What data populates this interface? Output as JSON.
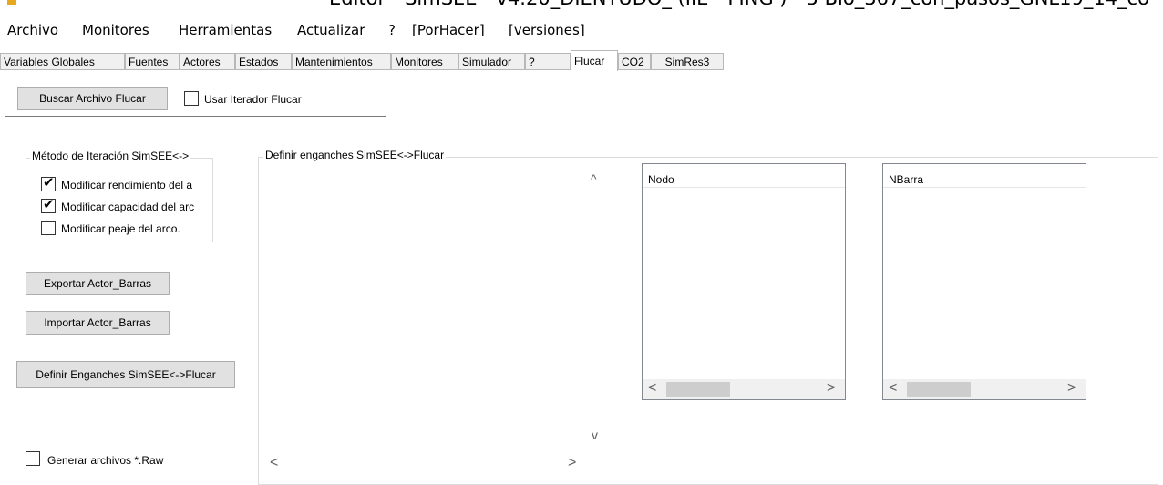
{
  "window": {
    "title": "Editor - SimSEE - v4.20_DIENTUDO_ (IIE - FING ) - 3-Bio_367_con_pasos_GNL19_14_co"
  },
  "menu": {
    "items": [
      "Archivo",
      "Monitores",
      "Herramientas",
      "Actualizar",
      "?",
      "[PorHacer]",
      "[versiones]"
    ]
  },
  "tabs": [
    "Variables Globales",
    "Fuentes",
    "Actores",
    "Estados",
    "Mantenimientos",
    "Monitores",
    "Simulador",
    "?",
    "Flucar",
    "CO2",
    "SimRes3"
  ],
  "active_tab": "Flucar",
  "flucar": {
    "buscar_button": "Buscar Archivo Flucar",
    "usar_iterador_label": "Usar Iterador Flucar",
    "usar_iterador_checked": false,
    "path_value": "",
    "iteracion_group_title": "Método de Iteración SimSEE<->",
    "iteracion_options": [
      {
        "label": "Modificar rendimiento del a",
        "checked": true
      },
      {
        "label": "Modificar capacidad del arc",
        "checked": true
      },
      {
        "label": "Modificar peaje del arco.",
        "checked": false
      }
    ],
    "exportar_button": "Exportar Actor_Barras",
    "importar_button": "Importar Actor_Barras",
    "definir_button": "Definir Enganches SimSEE<->Flucar",
    "generar_raw_label": "Generar archivos *.Raw",
    "generar_raw_checked": false,
    "enganches_group_title": "Definir enganches SimSEE<->Flucar",
    "nodo_header": "Nodo",
    "nbarra_header": "NBarra"
  },
  "icons": {
    "check": "✔",
    "scroll_left": "<",
    "scroll_right": ">",
    "scroll_up": "^",
    "scroll_down": "v"
  }
}
